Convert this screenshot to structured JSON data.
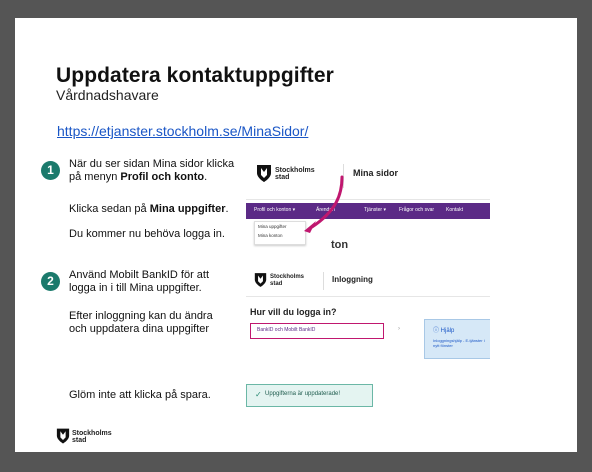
{
  "title": "Uppdatera kontaktuppgifter",
  "subtitle": "Vårdnadshavare",
  "link": "https://etjanster.stockholm.se/MinaSidor/",
  "step1": {
    "number": "1",
    "line1a": "När du ser sidan Mina sidor klicka",
    "line1b_pre": "på menyn ",
    "line1b_bold": "Profil och konto",
    "line1b_post": ".",
    "line2_pre": "Klicka sedan på ",
    "line2_bold": "Mina uppgifter",
    "line2_post": ".",
    "line3": "Du kommer nu behöva logga in."
  },
  "step2": {
    "number": "2",
    "line1a": "Använd Mobilt BankID för att",
    "line1b": "logga in i till Mina uppgifter.",
    "line2a": "Efter inloggning kan du ändra",
    "line2b": "och uppdatera dina uppgifter"
  },
  "step3": {
    "text": "Glöm inte att klicka på spara."
  },
  "logo": {
    "line1": "Stockholms",
    "line2": "stad"
  },
  "shot1": {
    "header_title": "Mina sidor",
    "nav": [
      "Profil och konton ▾",
      "Ärenden",
      "Tjänster ▾",
      "Frågor och svar",
      "Kontakt"
    ],
    "dropdown": [
      "Mina uppgifter",
      "Mina konton"
    ],
    "heading": "ton"
  },
  "shot2": {
    "header_title": "Inloggning",
    "question": "Hur vill du logga in?",
    "select_value": "BankID och Mobilt BankID",
    "chevron": "›",
    "help_title": "ⓘ Hjälp",
    "help_text": "Inloggningshjälp - E-tjänster i nytt fönster"
  },
  "shot3": {
    "check": "✓",
    "text": "Uppgifterna är uppdaterade!"
  },
  "colors": {
    "accent_teal": "#1b7a6c",
    "nav_purple": "#5b2a86",
    "highlight_magenta": "#c0176f",
    "link_blue": "#1a56c6"
  }
}
